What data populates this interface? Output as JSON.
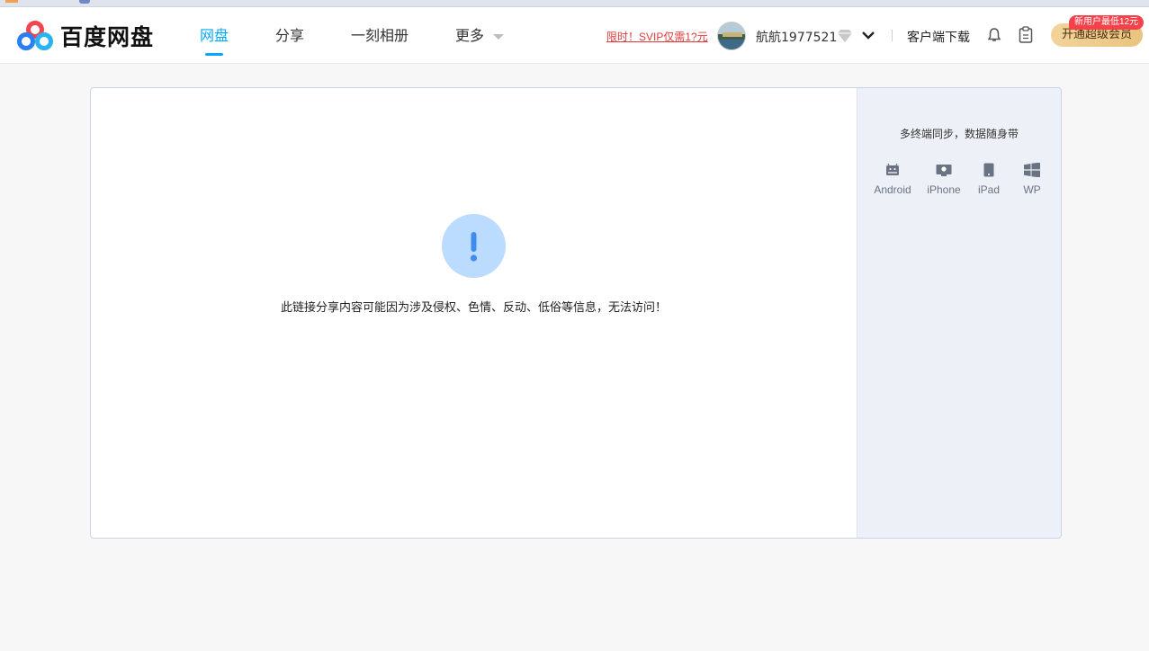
{
  "header": {
    "logo_text": "百度网盘",
    "nav": [
      {
        "label": "网盘",
        "active": true
      },
      {
        "label": "分享",
        "active": false
      },
      {
        "label": "一刻相册",
        "active": false
      },
      {
        "label": "更多",
        "active": false
      }
    ],
    "promo_link": "限时！SVIP仅需1?元",
    "username": "航航1977521",
    "client_download": "客户端下载",
    "svip_button": "开通超级会员",
    "new_user_badge": "新用户最低12元"
  },
  "main": {
    "message": "此链接分享内容可能因为涉及侵权、色情、反动、低俗等信息，无法访问！",
    "icon": "exclamation-icon"
  },
  "side": {
    "title": "多终端同步，数据随身带",
    "platforms": [
      {
        "label": "Android",
        "icon": "android-icon"
      },
      {
        "label": "iPhone",
        "icon": "iphone-icon"
      },
      {
        "label": "iPad",
        "icon": "ipad-icon"
      },
      {
        "label": "WP",
        "icon": "windows-icon"
      }
    ]
  },
  "colors": {
    "accent": "#06a7ff",
    "promo": "#e23a3a",
    "warn_circle": "#bcdcff",
    "warn_mark": "#3f8cf0",
    "svip": "#e9c47e",
    "badge": "#f4424b"
  }
}
